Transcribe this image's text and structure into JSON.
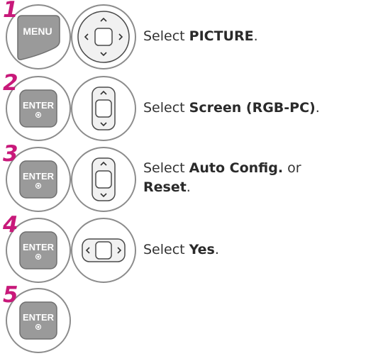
{
  "steps": [
    {
      "number": "1",
      "button": "MENU",
      "nav": "four-way",
      "text_pre": "Select ",
      "text_bold": "PICTURE",
      "text_post": "."
    },
    {
      "number": "2",
      "button": "ENTER",
      "nav": "up-down",
      "text_pre": "Select ",
      "text_bold": "Screen (RGB-PC)",
      "text_post": "."
    },
    {
      "number": "3",
      "button": "ENTER",
      "nav": "up-down",
      "text_pre": "Select ",
      "text_bold": "Auto Config.",
      "text_mid": " or",
      "text_bold2": "Reset",
      "text_post": "."
    },
    {
      "number": "4",
      "button": "ENTER",
      "nav": "left-right",
      "text_pre": "Select ",
      "text_bold": "Yes",
      "text_post": "."
    },
    {
      "number": "5",
      "button": "ENTER",
      "nav": "none"
    }
  ],
  "colors": {
    "step_number": "#c8197a",
    "button_gray": "#9a9a9a",
    "circle_border": "#8c8c8c"
  },
  "icons": {
    "menu_button": "menu-key-icon",
    "enter_button": "enter-key-icon",
    "navigation": "nav-pad-icon"
  }
}
